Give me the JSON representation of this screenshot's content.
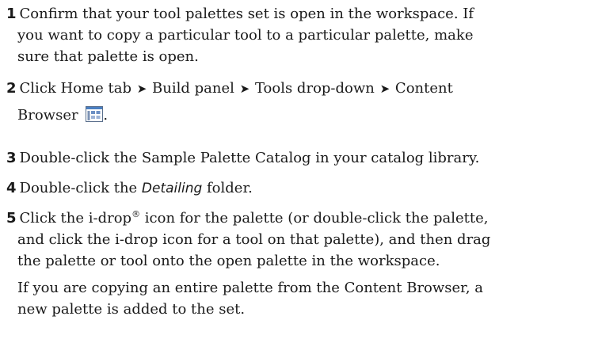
{
  "steps": [
    {
      "number": "1",
      "line1": "Confirm that your tool palettes set is open in the workspace. If",
      "line2": "you want to copy a particular tool to a particular palette, make",
      "line3": "sure that palette is open."
    },
    {
      "number": "2",
      "part1": "Click Home tab",
      "part2": "Build panel",
      "part3": "Tools drop-down",
      "part4": "Content",
      "part5": "Browser",
      "arrow": "➤",
      "after_icon": ".",
      "icon": "content-browser-icon"
    },
    {
      "number": "3",
      "text": "Double-click the Sample Palette Catalog in your catalog library."
    },
    {
      "number": "4",
      "before": "Double-click the ",
      "emphasis": "Detailing",
      "after": " folder."
    },
    {
      "number": "5",
      "line1_a": "Click the i-drop",
      "reg": "®",
      "line1_b": " icon for the palette (or double-click the palette,",
      "line2": "and click the i-drop icon for a tool on that palette), and then drag",
      "line3": "the palette or tool onto the open palette in the workspace."
    }
  ],
  "note": {
    "line1": "If you are copying an entire palette from the Content Browser, a",
    "line2": "new palette is added to the set."
  },
  "colors": {
    "text": "#1a1a1a",
    "icon_blue": "#4a7fc1"
  }
}
